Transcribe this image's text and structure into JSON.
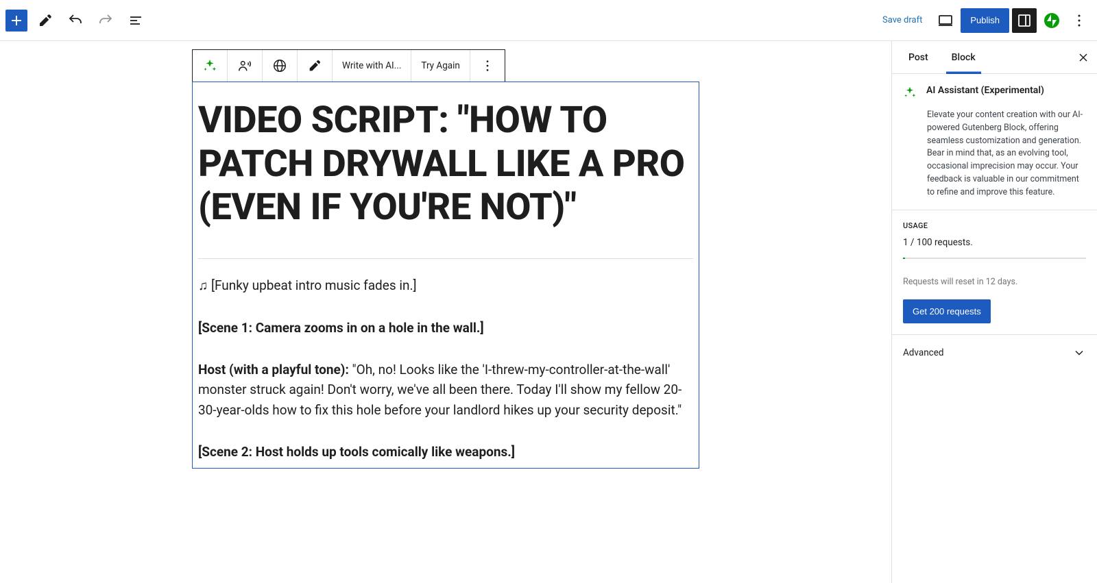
{
  "topbar": {
    "save_draft": "Save draft",
    "publish": "Publish"
  },
  "block_toolbar": {
    "write_ai": "Write with AI...",
    "try_again": "Try Again"
  },
  "content": {
    "title": "VIDEO SCRIPT: \"HOW TO PATCH DRYWALL LIKE A PRO (EVEN IF YOU'RE NOT)\"",
    "intro_music": "♫ [Funky upbeat intro music fades in.]",
    "scene1": "[Scene 1: Camera zooms in on a hole in the wall.]",
    "host_prefix": "Host (with a playful tone):",
    "host_line": " \"Oh, no! Looks like the 'I-threw-my-controller-at-the-wall' monster struck again! Don't worry, we've all been there. Today I'll show my fellow 20-30-year-olds how to fix this hole before your landlord hikes up your security deposit.\"",
    "scene2": "[Scene 2: Host holds up tools comically like weapons.]"
  },
  "sidebar": {
    "tab_post": "Post",
    "tab_block": "Block",
    "ai_title": "AI Assistant (Experimental)",
    "ai_desc": "Elevate your content creation with our AI-powered Gutenberg Block, offering seamless customization and generation. Bear in mind that, as an evolving tool, occasional imprecision may occur. Your feedback is valuable in our commitment to refine and improve this feature.",
    "usage_label": "USAGE",
    "usage_text": "1 / 100 requests.",
    "usage_reset": "Requests will reset in 12 days.",
    "get_requests": "Get 200 requests",
    "advanced": "Advanced"
  }
}
